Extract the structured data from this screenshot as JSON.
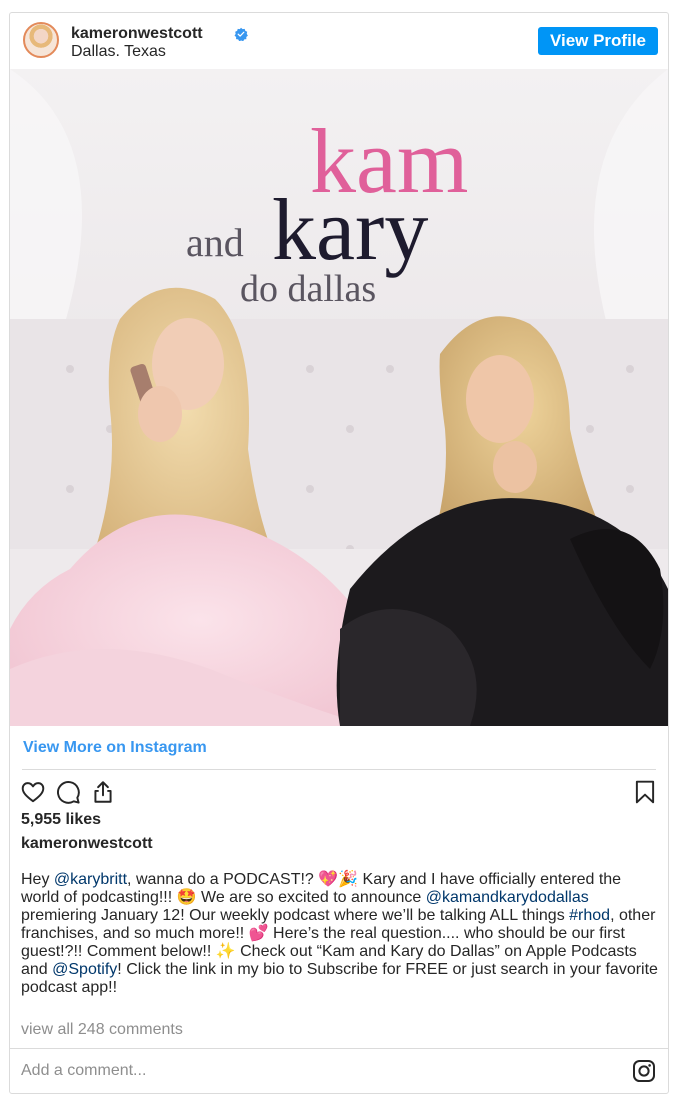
{
  "post": {
    "username": "kameronwestcott",
    "location": "Dallas. Texas",
    "view_profile_label": "View Profile",
    "image": {
      "title_kam": "kam",
      "title_and": "and",
      "title_kary": "kary",
      "title_do_dallas": "do dallas"
    },
    "view_more_label": "View More on Instagram",
    "likes": "5,955 likes",
    "caption_user": "kameronwestcott",
    "caption": {
      "p1": "Hey ",
      "m1": "@karybritt",
      "p2": ", wanna do a PODCAST!? 💖🎉 Kary and I have officially entered the world of podcasting!!! 🤩 We are so excited to announce ",
      "m2": "@kamandkarydodallas",
      "p3": " premiering January 12! Our weekly podcast where we’ll be talking ALL things ",
      "m3": "#rhod",
      "p4": ", other franchises, and so much more!! 💕 Here’s the real question.... who should be our first guest!?!! Comment below!! ✨ Check out “Kam and Kary do Dallas” on Apple Podcasts and ",
      "m4": "@Spotify",
      "p5": "! Click the link in my bio to Subscribe for FREE or just search in your favorite podcast app!!"
    },
    "view_all_comments": "view all 248 comments",
    "add_comment_placeholder": "Add a comment..."
  },
  "colors": {
    "accent": "#0095f6",
    "link": "#3897f0",
    "mention": "#00376b",
    "title_pink": "#e0609a",
    "title_dark": "#1e1b2e",
    "title_gray": "#5a5560"
  },
  "icons": [
    "verified-badge-icon",
    "heart-icon",
    "comment-icon",
    "share-icon",
    "bookmark-icon",
    "instagram-icon"
  ]
}
